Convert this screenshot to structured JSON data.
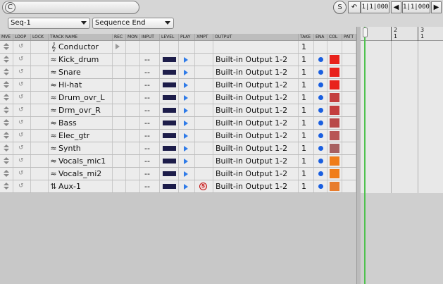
{
  "toolbar": {
    "c_label": "C",
    "sequence": "Seq-1",
    "marker": "Sequence End",
    "s_label": "S",
    "rewind_icon": "rewind-icon",
    "start_pos": "1|1|000",
    "prev_icon": "prev-icon",
    "end_pos": "1|1|000",
    "next_icon": "next-icon"
  },
  "headers": [
    "MVE",
    "LOOP",
    "LOCK",
    "TRACK NAME",
    "REC",
    "MON",
    "INPUT",
    "LEVEL",
    "PLAY",
    "XMPT",
    "OUTPUT",
    "TAKE",
    "ENA",
    "COL",
    "PATT"
  ],
  "conductor": {
    "name": "Conductor",
    "take": "1"
  },
  "tracks": [
    {
      "name": "Kick_drum",
      "input": "--",
      "output": "Built-in Output 1-2",
      "take": "1",
      "color": "#e8221c"
    },
    {
      "name": "Snare",
      "input": "--",
      "output": "Built-in Output 1-2",
      "take": "1",
      "color": "#e8221c"
    },
    {
      "name": "Hi-hat",
      "input": "--",
      "output": "Built-in Output 1-2",
      "take": "1",
      "color": "#e8221c"
    },
    {
      "name": "Drum_ovr_L",
      "input": "--",
      "output": "Built-in Output 1-2",
      "take": "1",
      "color": "#c43f3f"
    },
    {
      "name": "Drm_ovr_R",
      "input": "--",
      "output": "Built-in Output 1-2",
      "take": "1",
      "color": "#c43f3f"
    },
    {
      "name": "Bass",
      "input": "--",
      "output": "Built-in Output 1-2",
      "take": "1",
      "color": "#b94a4a"
    },
    {
      "name": "Elec_gtr",
      "input": "--",
      "output": "Built-in Output 1-2",
      "take": "1",
      "color": "#b85656"
    },
    {
      "name": "Synth",
      "input": "--",
      "output": "Built-in Output 1-2",
      "take": "1",
      "color": "#a86060"
    },
    {
      "name": "Vocals_mic1",
      "input": "--",
      "output": "Built-in Output 1-2",
      "take": "1",
      "color": "#f07d1a"
    },
    {
      "name": "Vocals_mi2",
      "input": "--",
      "output": "Built-in Output 1-2",
      "take": "1",
      "color": "#f07d1a"
    }
  ],
  "aux": {
    "name": "Aux-1",
    "input": "--",
    "output": "Built-in Output 1-2",
    "take": "1",
    "color": "#e87d2e",
    "xmpt": "S"
  },
  "timeline": {
    "bars": [
      {
        "top": "2",
        "bottom": "1"
      },
      {
        "top": "3",
        "bottom": "1"
      }
    ]
  }
}
